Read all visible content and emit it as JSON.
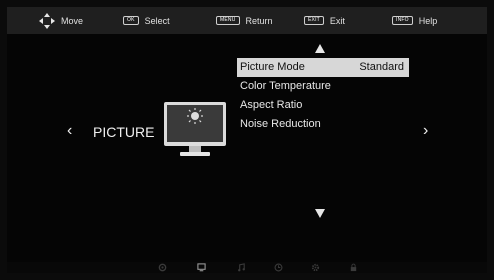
{
  "topbar": {
    "hints": [
      {
        "key": "",
        "label": "Move"
      },
      {
        "key": "OK",
        "label": "Select"
      },
      {
        "key": "MENU",
        "label": "Return"
      },
      {
        "key": "EXIT",
        "label": "Exit"
      },
      {
        "key": "INFO",
        "label": "Help"
      }
    ]
  },
  "category": {
    "label": "PICTURE",
    "left_arrow": "‹",
    "right_arrow": "›",
    "icon": "monitor-icon"
  },
  "menu": {
    "items": [
      {
        "label": "Picture Mode",
        "value": "Standard"
      },
      {
        "label": "Color Temperature",
        "value": ""
      },
      {
        "label": "Aspect Ratio",
        "value": ""
      },
      {
        "label": "Noise Reduction",
        "value": ""
      }
    ]
  },
  "bottom_icons": [
    "settings-wheel-icon",
    "picture-icon",
    "music-icon",
    "clock-icon",
    "gear-icon",
    "lock-icon"
  ],
  "colors": {
    "background": "#050505",
    "topbar": "#1f1f1f",
    "highlight": "#d7d7d7",
    "text": "#e6e6e6"
  }
}
